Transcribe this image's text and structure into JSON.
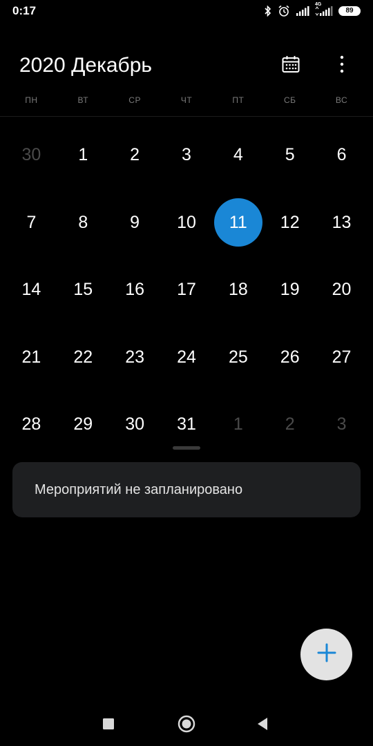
{
  "status_bar": {
    "time": "0:17",
    "network_label": "4G",
    "battery": "89"
  },
  "header": {
    "title": "2020 Декабрь"
  },
  "weekdays": [
    "ПН",
    "ВТ",
    "СР",
    "ЧТ",
    "ПТ",
    "СБ",
    "ВС"
  ],
  "days": [
    {
      "label": "30",
      "muted": true
    },
    {
      "label": "1"
    },
    {
      "label": "2"
    },
    {
      "label": "3"
    },
    {
      "label": "4"
    },
    {
      "label": "5"
    },
    {
      "label": "6"
    },
    {
      "label": "7"
    },
    {
      "label": "8"
    },
    {
      "label": "9"
    },
    {
      "label": "10"
    },
    {
      "label": "11",
      "selected": true
    },
    {
      "label": "12"
    },
    {
      "label": "13"
    },
    {
      "label": "14"
    },
    {
      "label": "15"
    },
    {
      "label": "16"
    },
    {
      "label": "17"
    },
    {
      "label": "18"
    },
    {
      "label": "19"
    },
    {
      "label": "20"
    },
    {
      "label": "21"
    },
    {
      "label": "22"
    },
    {
      "label": "23"
    },
    {
      "label": "24"
    },
    {
      "label": "25"
    },
    {
      "label": "26"
    },
    {
      "label": "27"
    },
    {
      "label": "28"
    },
    {
      "label": "29"
    },
    {
      "label": "30"
    },
    {
      "label": "31"
    },
    {
      "label": "1",
      "muted": true
    },
    {
      "label": "2",
      "muted": true
    },
    {
      "label": "3",
      "muted": true
    }
  ],
  "events": {
    "empty_text": "Мероприятий не запланировано"
  },
  "colors": {
    "accent": "#1a87d6",
    "background": "#000000",
    "card": "#1e1f21",
    "fab": "#e3e3e3"
  },
  "icons": {
    "calendar_button": "calendar-grid-icon",
    "menu_button": "more-vert-icon",
    "fab": "plus-icon",
    "nav_recents": "square-icon",
    "nav_home": "circle-icon",
    "nav_back": "triangle-back-icon"
  }
}
